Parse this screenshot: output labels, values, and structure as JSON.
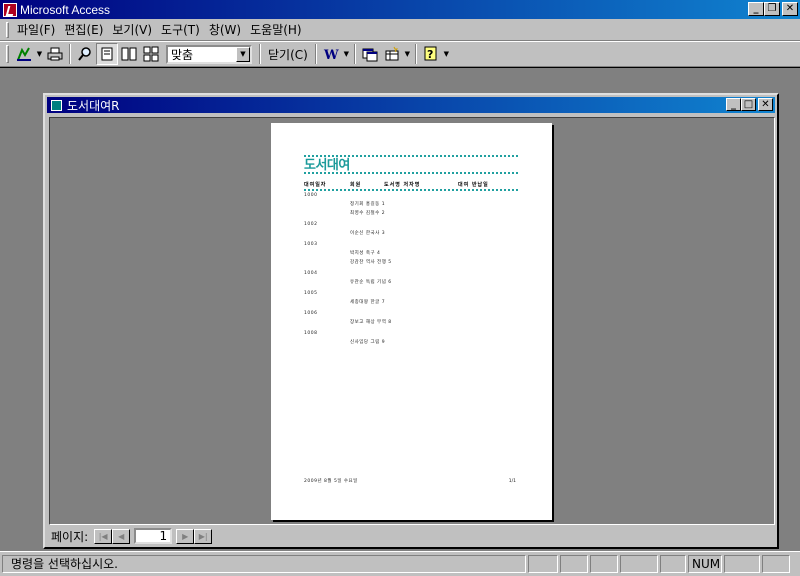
{
  "app": {
    "title": "Microsoft Access"
  },
  "window_buttons": {
    "minimize": "_",
    "restore": "❐",
    "close": "✕"
  },
  "menu": {
    "items": [
      "파일(F)",
      "편집(E)",
      "보기(V)",
      "도구(T)",
      "창(W)",
      "도움말(H)"
    ]
  },
  "toolbar": {
    "zoom_value": "맞춤",
    "close_label": "닫기(C)",
    "icons": [
      "view-icon",
      "print-icon",
      "zoom-icon",
      "one-page-icon",
      "two-pages-icon",
      "multiple-pages-icon",
      "word-icon",
      "database-window-icon",
      "new-object-icon",
      "help-icon"
    ]
  },
  "child_window": {
    "title": "도서대여R"
  },
  "report": {
    "title": "도서대여",
    "header": [
      "대여일자",
      "회원",
      "도서명 저자명",
      "대여 반납일"
    ],
    "groups": [
      {
        "id": "1000",
        "lines": [
          "정기회 홍길동 1",
          "최영수 김철수 2"
        ]
      },
      {
        "id": "1002",
        "lines": [
          "이순신 한국사 3"
        ]
      },
      {
        "id": "1003",
        "lines": [
          "박지성 축구 4",
          "강감찬 역사 전쟁 5"
        ]
      },
      {
        "id": "1004",
        "lines": [
          "유관순 독립 기념 6"
        ]
      },
      {
        "id": "1005",
        "lines": [
          "세종대왕 한글 7"
        ]
      },
      {
        "id": "1006",
        "lines": [
          "장보고 해상 무역 8"
        ]
      },
      {
        "id": "1008",
        "lines": [
          "신사임당 그림 9"
        ]
      }
    ],
    "footer_left": "2009년 8월 5일 수요일",
    "footer_right": "1/1"
  },
  "navbar": {
    "label": "페이지:",
    "page": "1"
  },
  "status": {
    "message": "명령을 선택하십시오.",
    "num": "NUM"
  }
}
